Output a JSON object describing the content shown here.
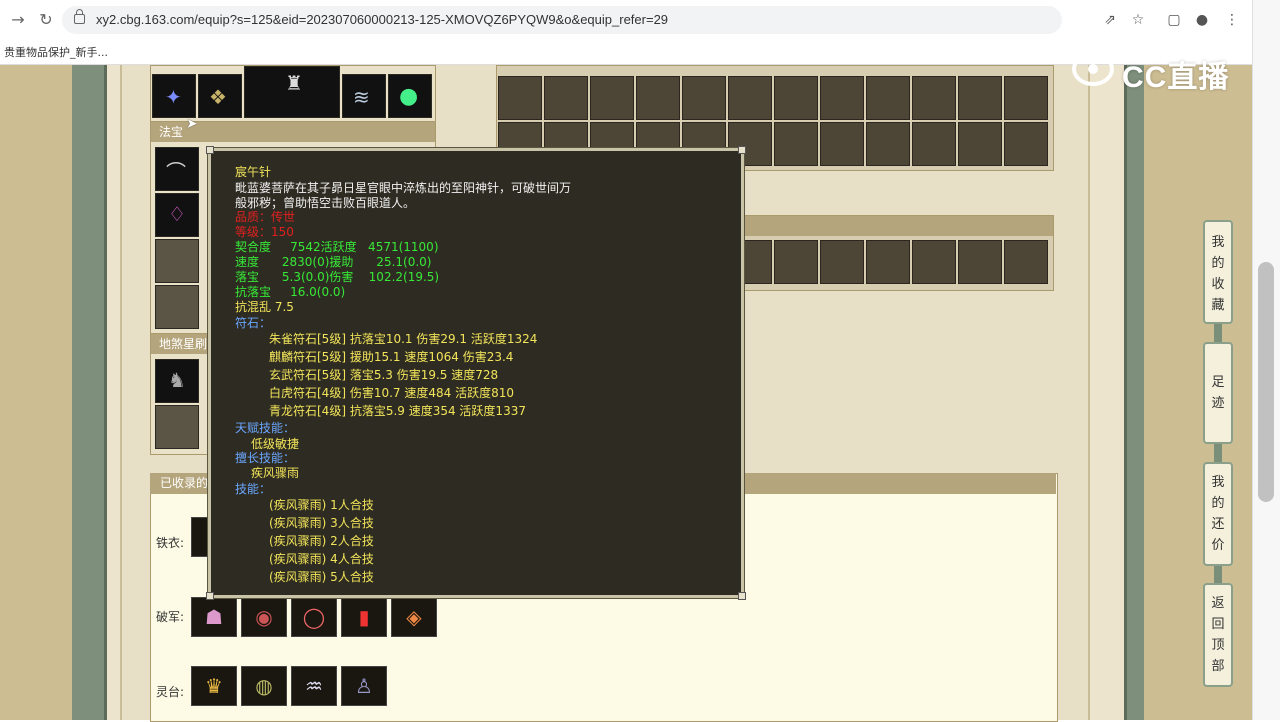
{
  "browser": {
    "url": "xy2.cbg.163.com/equip?s=125&eid=202307060000213-125-XMOVQZ6PYQW9&o&equip_refer=29",
    "bookmark": "贵重物品保护_新手..."
  },
  "watermark": "CC直播",
  "panels": {
    "fabao_title": "法宝",
    "disha_title": "地煞星刷",
    "collected_title": "已收录的"
  },
  "collected_rows": [
    {
      "label": "铁衣:"
    },
    {
      "label": "破军:"
    },
    {
      "label": "灵台:"
    }
  ],
  "tooltip": {
    "name": "宸午针",
    "desc_line1": "毗蓝婆菩萨在其子昴日星官眼中淬炼出的至阳神针，可破世间万",
    "desc_line2": "般邪秽；曾助悟空击败百眼道人。",
    "quality": "品质：传世",
    "level": "等级：150",
    "stats": [
      "契合度     7542活跃度   4571(1100)",
      "速度      2830(0)援助      25.1(0.0)",
      "落宝      5.3(0.0)伤害    102.2(19.5)",
      "抗落宝     16.0(0.0)"
    ],
    "anti_chaos": "抗混乱 7.5",
    "runes_title": "符石：",
    "runes": [
      "朱雀符石[5级] 抗落宝10.1 伤害29.1 活跃度1324",
      "麒麟符石[5级] 援助15.1 速度1064 伤害23.4",
      "玄武符石[5级] 落宝5.3 伤害19.5 速度728",
      "白虎符石[4级] 伤害10.7 速度484 活跃度810",
      "青龙符石[4级] 抗落宝5.9 速度354 活跃度1337"
    ],
    "talent_title": "天赋技能：",
    "talent": "低级敏捷",
    "specialty_title": "擅长技能：",
    "specialty": "疾风骤雨",
    "skills_title": "技能：",
    "skills": [
      "(疾风骤雨) 1人合技",
      "(疾风骤雨) 3人合技",
      "(疾风骤雨) 2人合技",
      "(疾风骤雨) 4人合技",
      "(疾风骤雨) 5人合技"
    ]
  },
  "side_nav": [
    {
      "label": "我的收藏"
    },
    {
      "label": "足迹"
    },
    {
      "label": "我的还价"
    },
    {
      "label": "返回顶部"
    }
  ],
  "colors": {
    "tooltip_bg": "#2e2c22",
    "title_yellow": "#f2e45a",
    "stat_green": "#37e837",
    "quality_red": "#e02020",
    "section_blue": "#6aa6ff"
  }
}
